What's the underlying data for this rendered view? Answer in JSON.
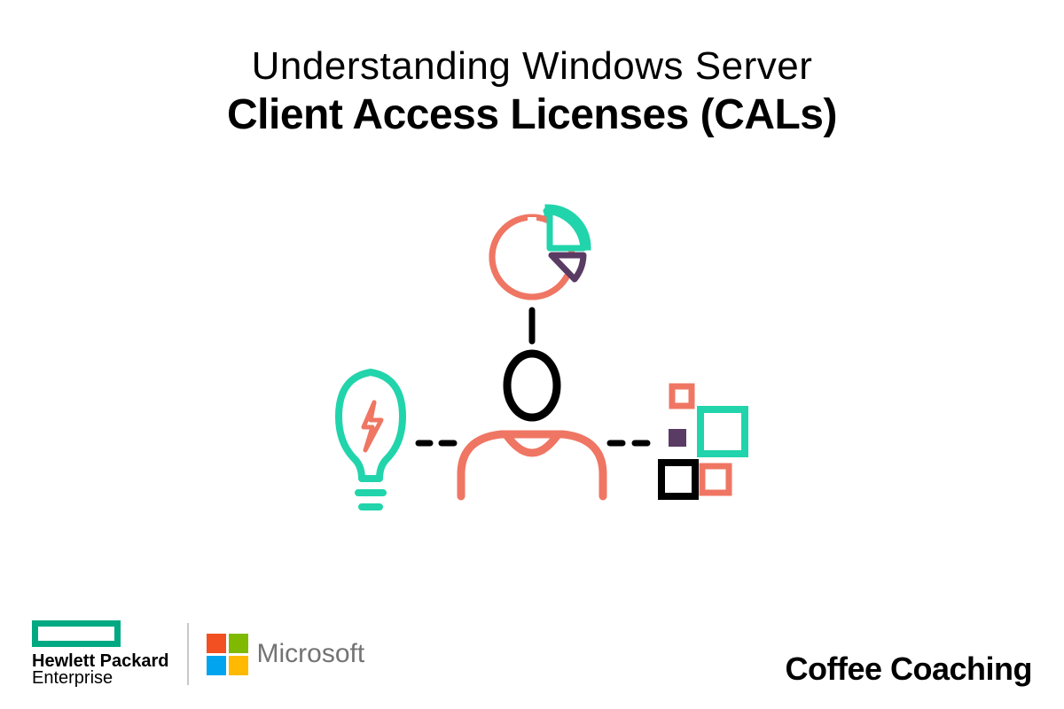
{
  "title": {
    "line1": "Understanding Windows Server",
    "line2": "Client Access Licenses (CALs)"
  },
  "footer": {
    "hpe": {
      "line1": "Hewlett Packard",
      "line2": "Enterprise"
    },
    "microsoft": "Microsoft",
    "brand": "Coffee Coaching"
  },
  "colors": {
    "hpe_green": "#01a982",
    "coral": "#ef7663",
    "teal": "#21d4ab",
    "plum": "#5a3b63",
    "es_purple": "#5a3b63"
  }
}
